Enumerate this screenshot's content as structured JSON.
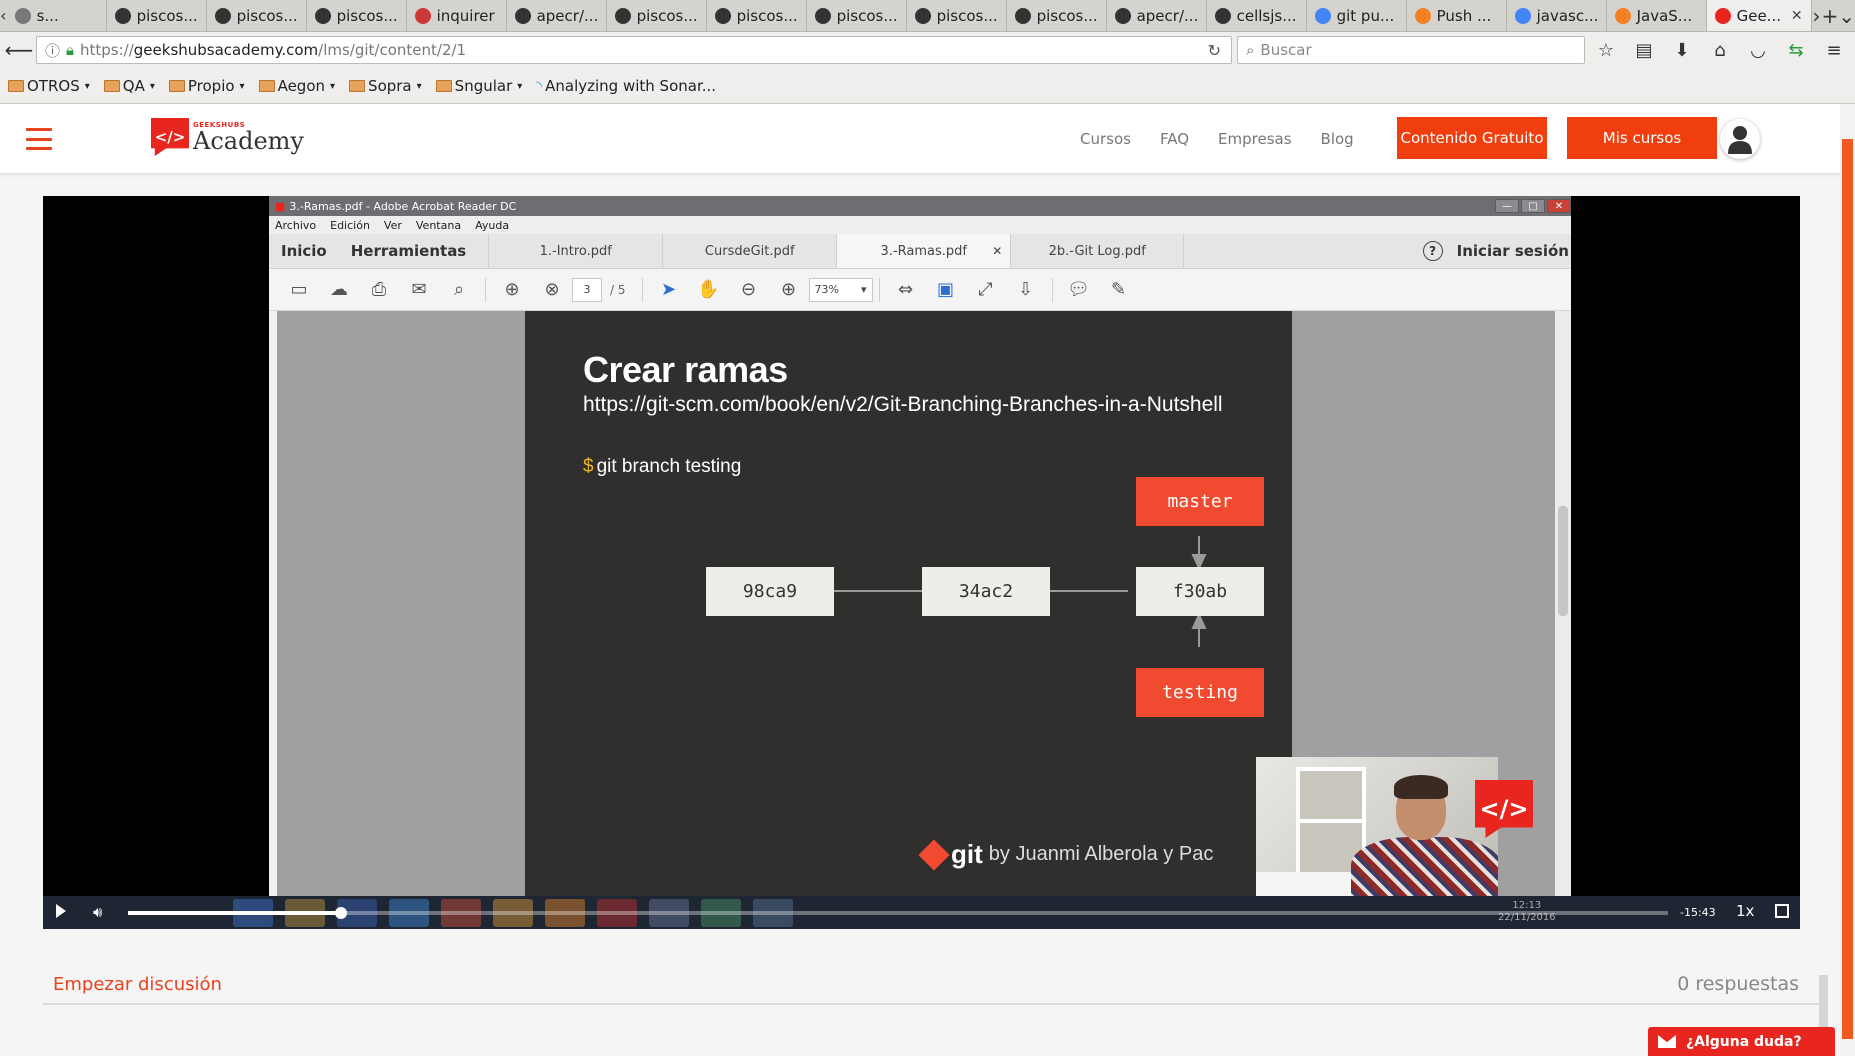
{
  "browser": {
    "tabs": [
      {
        "label": "s...",
        "icon": "page-icon",
        "color": "#777777"
      },
      {
        "label": "piscos...",
        "icon": "github-icon",
        "color": "#333333"
      },
      {
        "label": "piscos...",
        "icon": "github-icon",
        "color": "#333333"
      },
      {
        "label": "piscos...",
        "icon": "github-icon",
        "color": "#333333"
      },
      {
        "label": "inquirer",
        "icon": "npm-icon",
        "color": "#cb3837"
      },
      {
        "label": "apecr/...",
        "icon": "github-icon",
        "color": "#333333"
      },
      {
        "label": "piscos...",
        "icon": "github-icon",
        "color": "#333333"
      },
      {
        "label": "piscos...",
        "icon": "github-icon",
        "color": "#333333"
      },
      {
        "label": "piscos...",
        "icon": "github-icon",
        "color": "#333333"
      },
      {
        "label": "piscos...",
        "icon": "github-icon",
        "color": "#333333"
      },
      {
        "label": "piscos...",
        "icon": "github-icon",
        "color": "#333333"
      },
      {
        "label": "apecr/...",
        "icon": "github-icon",
        "color": "#333333"
      },
      {
        "label": "cellsjs...",
        "icon": "github-icon",
        "color": "#333333"
      },
      {
        "label": "git pu...",
        "icon": "google-icon",
        "color": "#4285f4"
      },
      {
        "label": "Push ...",
        "icon": "stackoverflow-icon",
        "color": "#f48024"
      },
      {
        "label": "javasc...",
        "icon": "google-icon",
        "color": "#4285f4"
      },
      {
        "label": "JavaS...",
        "icon": "stackoverflow-icon",
        "color": "#f48024"
      },
      {
        "label": "Gee...",
        "icon": "geekshubs-icon",
        "color": "#e8251f",
        "active": true
      }
    ],
    "url_prefix": "https://",
    "url_host": "geekshubsacademy.com",
    "url_path": "/lms/git/content/2/1",
    "search_placeholder": "Buscar",
    "bookmarks": [
      {
        "label": "OTROS"
      },
      {
        "label": "QA"
      },
      {
        "label": "Propio"
      },
      {
        "label": "Aegon"
      },
      {
        "label": "Sopra"
      },
      {
        "label": "Sngular"
      }
    ],
    "bookmark_link": "Analyzing with Sonar..."
  },
  "site": {
    "logo_small": "GEEKSHUBS",
    "logo_text": "Academy",
    "logo_badge": "</>",
    "nav": [
      "Cursos",
      "FAQ",
      "Empresas",
      "Blog"
    ],
    "btn_free": "Contenido Gratuito",
    "btn_courses": "Mis cursos",
    "accent": "#f03e0f"
  },
  "acrobat": {
    "window_title": "3.-Ramas.pdf - Adobe Acrobat Reader DC",
    "menu": [
      "Archivo",
      "Edición",
      "Ver",
      "Ventana",
      "Ayuda"
    ],
    "home_tabs": [
      "Inicio",
      "Herramientas"
    ],
    "doc_tabs": [
      "1.-Intro.pdf",
      "CursdeGit.pdf",
      "3.-Ramas.pdf",
      "2b.-Git Log.pdf"
    ],
    "active_doc": "3.-Ramas.pdf",
    "signin": "Iniciar sesión",
    "help": "?",
    "page_current": "3",
    "page_total": "/ 5",
    "zoom": "73%"
  },
  "slide": {
    "title": "Crear ramas",
    "url": "https://git-scm.com/book/en/v2/Git-Branching-Branches-in-a-Nutshell",
    "cmd_prompt": "$",
    "cmd": "git branch testing",
    "commits": [
      "98ca9",
      "34ac2",
      "f30ab"
    ],
    "branch_master": "master",
    "branch_testing": "testing",
    "footer_git": "git",
    "footer_by": "by Juanmi Alberola y Pac"
  },
  "player": {
    "progress": 0.138,
    "time_remaining": "-15:43",
    "rate": "1x",
    "clock": "12:13",
    "date": "22/11/2016"
  },
  "discussion": {
    "start": "Empezar discusión",
    "count": "0 respuestas"
  },
  "help_widget": "¿Alguna duda?"
}
